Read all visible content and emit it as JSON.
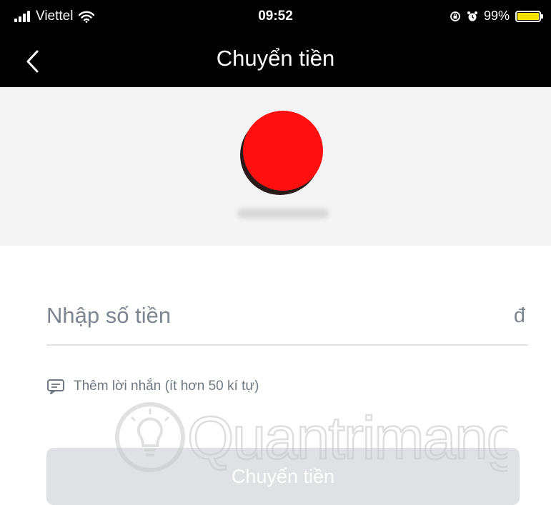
{
  "status_bar": {
    "carrier": "Viettel",
    "time": "09:52",
    "battery": "99%",
    "battery_level": 0.99,
    "icons": [
      "signal-icon",
      "wifi-icon",
      "rotation-lock-icon",
      "alarm-icon",
      "battery-icon"
    ]
  },
  "nav": {
    "back_icon": "chevron-left-icon",
    "title": "Chuyển tiền"
  },
  "recipient": {
    "avatar_color": "#ff1010",
    "name": ""
  },
  "form": {
    "amount_placeholder": "Nhập số tiền",
    "amount_value": "",
    "currency": "đ",
    "message_icon": "chat-icon",
    "message_label": "Thêm lời nhắn (ít hơn 50 kí tự)",
    "submit_label": "Chuyển tiền"
  },
  "watermark": {
    "text": "Quantrimang",
    "icon": "lightbulb-icon"
  },
  "colors": {
    "header_bg": "#000000",
    "recipient_bg": "#f4f4f4",
    "button_disabled": "#dfe1e4",
    "battery_fill": "#f5e000"
  }
}
